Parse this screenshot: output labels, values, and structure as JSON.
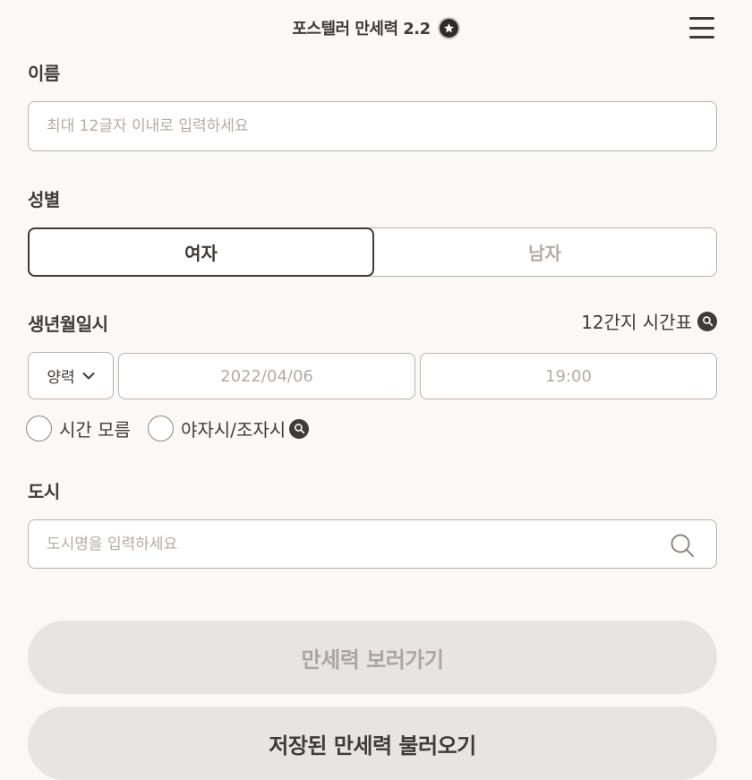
{
  "header": {
    "title": "포스텔러 만세력 2.2",
    "badge_icon": "star-badge-icon",
    "menu_icon": "hamburger-menu-icon"
  },
  "name_section": {
    "label": "이름",
    "placeholder": "최대 12글자 이내로 입력하세요",
    "value": ""
  },
  "gender_section": {
    "label": "성별",
    "options": [
      {
        "label": "여자",
        "selected": true
      },
      {
        "label": "남자",
        "selected": false
      }
    ]
  },
  "birth_section": {
    "label": "생년월일시",
    "table_link": "12간지 시간표",
    "calendar_type": "양력",
    "date_placeholder": "2022/04/06",
    "time_placeholder": "19:00",
    "unknown_time_label": "시간 모름",
    "night_time_label": "야자시/조자시"
  },
  "city_section": {
    "label": "도시",
    "placeholder": "도시명을 입력하세요",
    "value": ""
  },
  "actions": {
    "view_label": "만세력 보러가기",
    "load_label": "저장된 만세력 불러오기"
  },
  "colors": {
    "background": "#fbf9f7",
    "text": "#3f3b38",
    "placeholder": "#b3aca6",
    "button_bg": "#e7e5e4"
  }
}
